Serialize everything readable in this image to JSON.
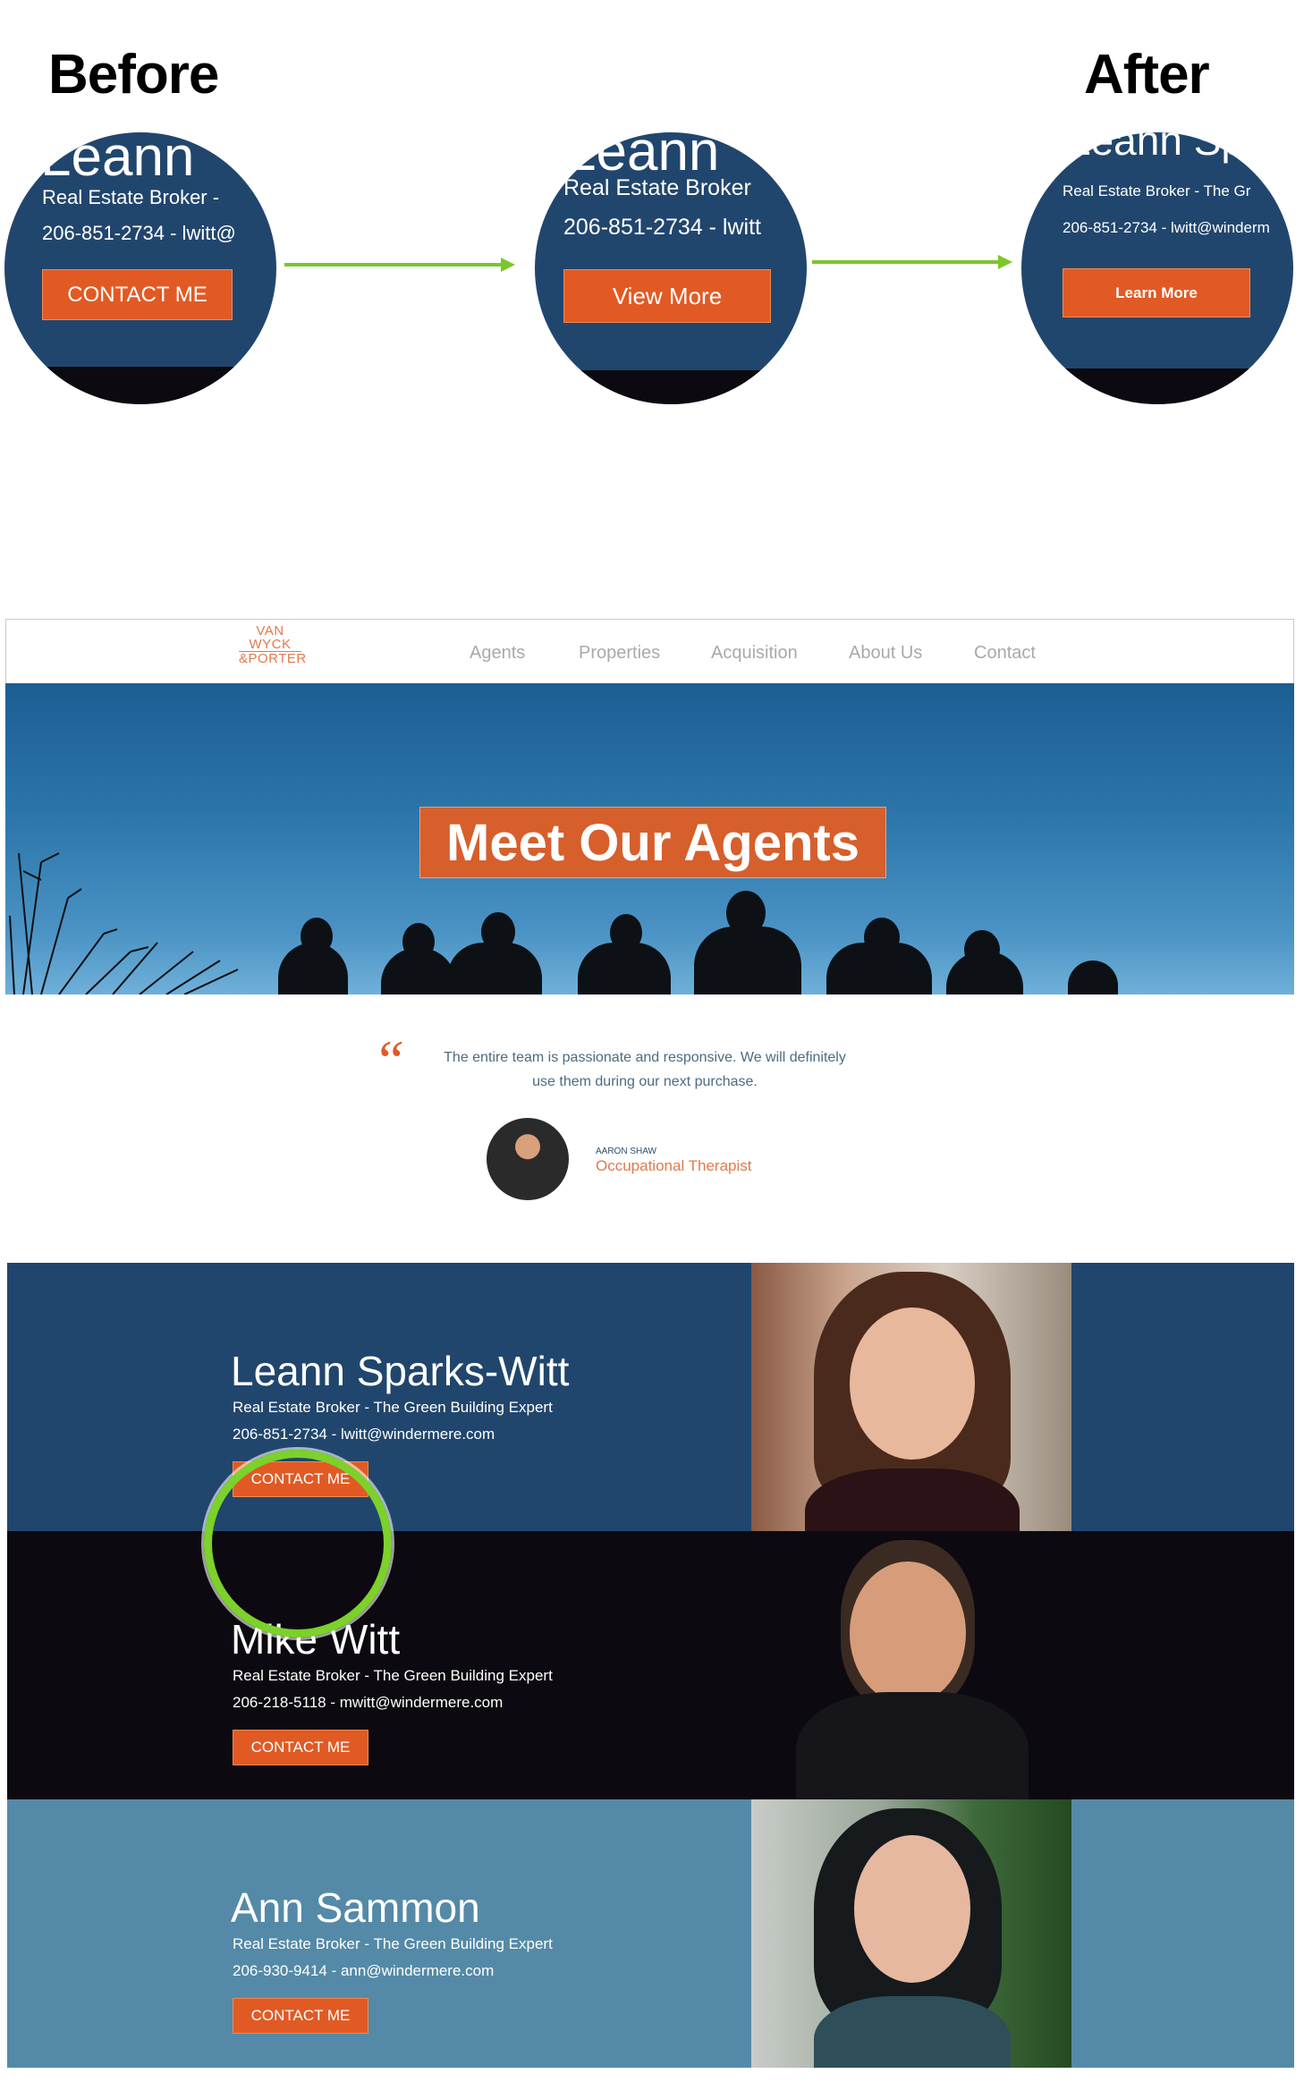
{
  "header": {
    "before_label": "Before",
    "after_label": "After"
  },
  "comparison": {
    "before": {
      "name_fragment": "Leann",
      "title_line": "Real Estate Broker  -",
      "contact_line": "206-851-2734  -  lwitt@",
      "button": "CONTACT ME"
    },
    "middle": {
      "name_fragment": "Leann",
      "title_line": "Real Estate Broker",
      "contact_line": "206-851-2734  -  lwitt",
      "button": "View More"
    },
    "after": {
      "name_fragment": "Leann Sp",
      "title_line": "Real Estate Broker  -  The Gr",
      "contact_line": "206-851-2734  -  lwitt@winderm",
      "button": "Learn More"
    }
  },
  "site": {
    "logo": [
      "VAN",
      "WYCK",
      "&PORTER"
    ],
    "nav": [
      "Agents",
      "Properties",
      "Acquisition",
      "About Us",
      "Contact"
    ],
    "hero_title": "Meet Our Agents",
    "testimonial": {
      "quote": "The entire team is passionate and responsive. We will definitely use them during our next purchase.",
      "author": "AARON SHAW",
      "role": "Occupational Therapist"
    },
    "agents": [
      {
        "name": "Leann Sparks-Witt",
        "title": "Real Estate Broker  -  The Green Building Expert",
        "contact": "206-851-2734  -  lwitt@windermere.com",
        "button": "CONTACT ME",
        "bg_color": "#21466d"
      },
      {
        "name": "Mike Witt",
        "title": "Real Estate Broker  -  The Green Building Expert",
        "contact": "206-218-5118  -  mwitt@windermere.com",
        "button": "CONTACT ME",
        "bg_color": "#0c0a10"
      },
      {
        "name": "Ann Sammon",
        "title": "Real Estate Broker  -  The Green Building Expert",
        "contact": "206-930-9414  -  ann@windermere.com",
        "button": "CONTACT ME",
        "bg_color": "#548aa7"
      }
    ]
  },
  "colors": {
    "accent_orange": "#e15a24",
    "highlight_green": "#7cc62b",
    "navy": "#21466d"
  }
}
